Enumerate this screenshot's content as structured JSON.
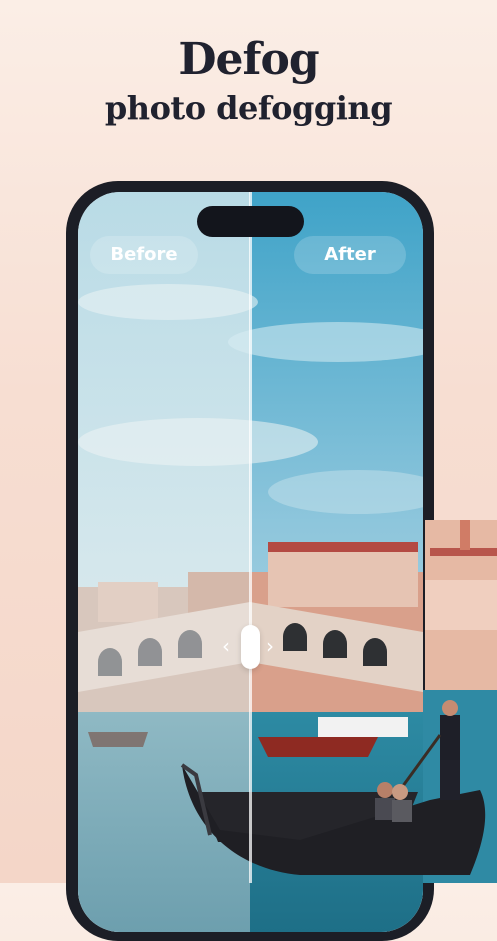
{
  "header": {
    "title": "Defog",
    "subtitle": "photo defogging"
  },
  "comparison": {
    "before_label": "Before",
    "after_label": "After"
  },
  "icons": {
    "left": "chevron-left-icon",
    "right": "chevron-right-icon"
  },
  "colors": {
    "title": "#20222f",
    "background": "#f7ded2",
    "phone_frame": "#1c1e26"
  }
}
